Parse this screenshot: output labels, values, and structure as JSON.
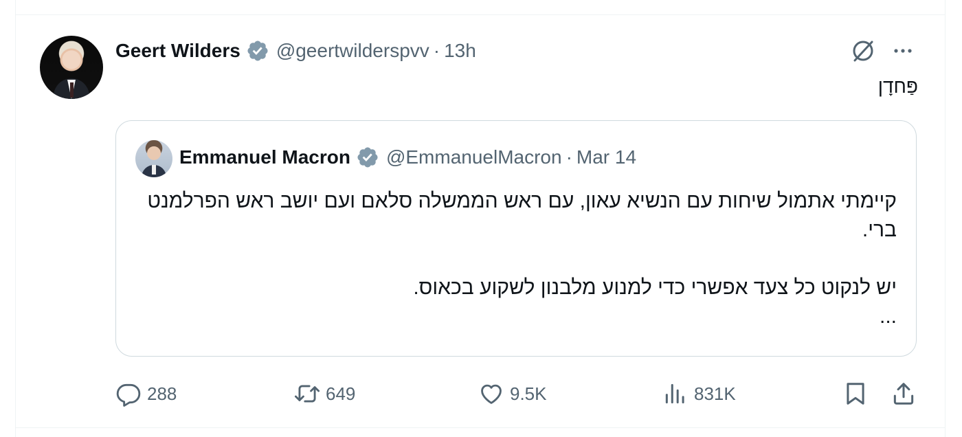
{
  "tweet": {
    "author": {
      "display_name": "Geert Wilders",
      "handle": "@geertwilderspvv",
      "verified": true
    },
    "separator": "·",
    "time": "13h",
    "text": "פַּחדָן"
  },
  "quoted_tweet": {
    "author": {
      "display_name": "Emmanuel Macron",
      "handle": "@EmmanuelMacron",
      "verified": true
    },
    "separator": "·",
    "time": "Mar 14",
    "paragraphs": [
      "קיימתי אתמול שיחות עם הנשיא עאון, עם ראש הממשלה סלאם ועם יושב ראש הפרלמנט ברי.",
      "יש לנקוט כל צעד אפשרי כדי למנוע מלבנון לשקוע בכאוס."
    ],
    "ellipsis": "..."
  },
  "actions": {
    "replies": "288",
    "retweets": "649",
    "likes": "9.5K",
    "views": "831K"
  },
  "colors": {
    "verified_badge": "#829aab",
    "text_primary": "#0f1419",
    "text_secondary": "#536471",
    "border": "#cfd9de"
  },
  "icons": [
    "grok-icon",
    "more-icon",
    "verified-badge-icon",
    "reply-icon",
    "retweet-icon",
    "like-icon",
    "views-icon",
    "bookmark-icon",
    "share-icon"
  ]
}
